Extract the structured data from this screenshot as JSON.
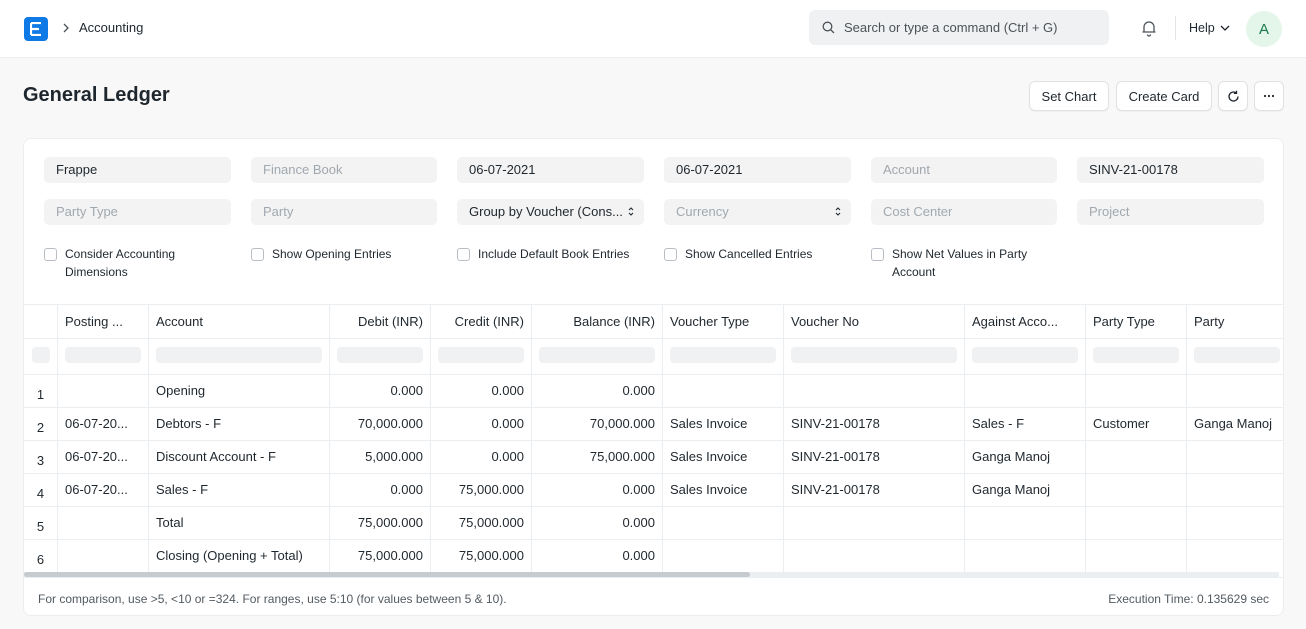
{
  "navbar": {
    "breadcrumb": "Accounting",
    "search_placeholder": "Search or type a command (Ctrl + G)",
    "help_label": "Help",
    "avatar_initial": "A"
  },
  "page": {
    "title": "General Ledger",
    "set_chart_label": "Set Chart",
    "create_card_label": "Create Card"
  },
  "filters": {
    "company": "Frappe",
    "finance_book": "Finance Book",
    "from_date": "06-07-2021",
    "to_date": "06-07-2021",
    "account": "Account",
    "voucher_no": "SINV-21-00178",
    "party_type": "Party Type",
    "party": "Party",
    "group_by": "Group by Voucher (Cons...",
    "currency": "Currency",
    "cost_center": "Cost Center",
    "project": "Project",
    "checkboxes": [
      {
        "label": "Consider Accounting Dimensions",
        "checked": false
      },
      {
        "label": "Show Opening Entries",
        "checked": false
      },
      {
        "label": "Include Default Book Entries",
        "checked": false
      },
      {
        "label": "Show Cancelled Entries",
        "checked": false
      },
      {
        "label": "Show Net Values in Party Account",
        "checked": false
      }
    ]
  },
  "table": {
    "columns": [
      "Posting ...",
      "Account",
      "Debit (INR)",
      "Credit (INR)",
      "Balance (INR)",
      "Voucher Type",
      "Voucher No",
      "Against Acco...",
      "Party Type",
      "Party"
    ],
    "rows": [
      {
        "n": "1",
        "posting": "",
        "account": "Opening",
        "debit": "0.000",
        "credit": "0.000",
        "balance": "0.000",
        "vtype": "",
        "vno": "",
        "against": "",
        "ptype": "",
        "party": ""
      },
      {
        "n": "2",
        "posting": "06-07-20...",
        "account": "Debtors - F",
        "debit": "70,000.000",
        "credit": "0.000",
        "balance": "70,000.000",
        "vtype": "Sales Invoice",
        "vno": "SINV-21-00178",
        "against": "Sales - F",
        "ptype": "Customer",
        "party": "Ganga Manoj"
      },
      {
        "n": "3",
        "posting": "06-07-20...",
        "account": "Discount Account - F",
        "debit": "5,000.000",
        "credit": "0.000",
        "balance": "75,000.000",
        "vtype": "Sales Invoice",
        "vno": "SINV-21-00178",
        "against": "Ganga Manoj",
        "ptype": "",
        "party": ""
      },
      {
        "n": "4",
        "posting": "06-07-20...",
        "account": "Sales - F",
        "debit": "0.000",
        "credit": "75,000.000",
        "balance": "0.000",
        "vtype": "Sales Invoice",
        "vno": "SINV-21-00178",
        "against": "Ganga Manoj",
        "ptype": "",
        "party": ""
      },
      {
        "n": "5",
        "posting": "",
        "account": "Total",
        "debit": "75,000.000",
        "credit": "75,000.000",
        "balance": "0.000",
        "vtype": "",
        "vno": "",
        "against": "",
        "ptype": "",
        "party": ""
      },
      {
        "n": "6",
        "posting": "",
        "account": "Closing (Opening + Total)",
        "debit": "75,000.000",
        "credit": "75,000.000",
        "balance": "0.000",
        "vtype": "",
        "vno": "",
        "against": "",
        "ptype": "",
        "party": ""
      }
    ]
  },
  "footer": {
    "hint": "For comparison, use >5, <10 or =324. For ranges, use 5:10 (for values between 5 & 10).",
    "execution_time": "Execution Time: 0.135629 sec"
  }
}
